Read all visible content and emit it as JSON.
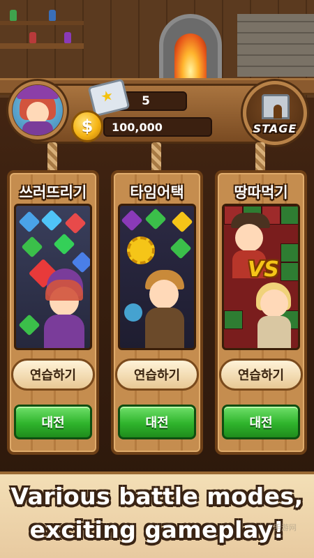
{
  "hud": {
    "star_count": "5",
    "gold": "100,000",
    "coin_symbol": "$",
    "stage_label": "STAGE"
  },
  "modes": [
    {
      "title": "쓰러뜨리기",
      "practice_label": "연습하기",
      "battle_label": "대전"
    },
    {
      "title": "타임어택",
      "practice_label": "연습하기",
      "battle_label": "대전"
    },
    {
      "title": "땅따먹기",
      "practice_label": "연습하기",
      "battle_label": "대전",
      "vs_text": "VS"
    }
  ],
  "banner": {
    "line1": "Various battle modes,",
    "line2": "exciting gameplay!"
  },
  "watermark": "手游网",
  "colors": {
    "battle_green": "#2fb42c",
    "wood": "#c58d4f",
    "gold": "#f5b415"
  }
}
